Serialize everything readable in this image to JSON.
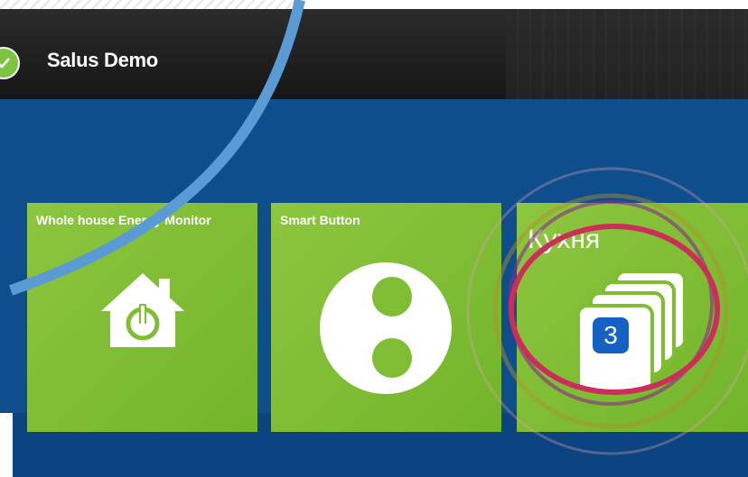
{
  "app": {
    "title": "Salus Demo"
  },
  "tiles": [
    {
      "label": "Whole house Energy Monitor",
      "icon": "home-power-icon"
    },
    {
      "label": "Smart Button",
      "icon": "smart-button-icon"
    },
    {
      "label": "Кухня",
      "icon": "stacked-devices-icon",
      "badge": "3"
    }
  ],
  "colors": {
    "header": "#1c1c1c",
    "background": "#0e4e8c",
    "tile": "#7fbd33",
    "badge": "#1662c4",
    "annotation_circle": "#cc2d5a",
    "annotation_line": "#5b9bd5"
  }
}
